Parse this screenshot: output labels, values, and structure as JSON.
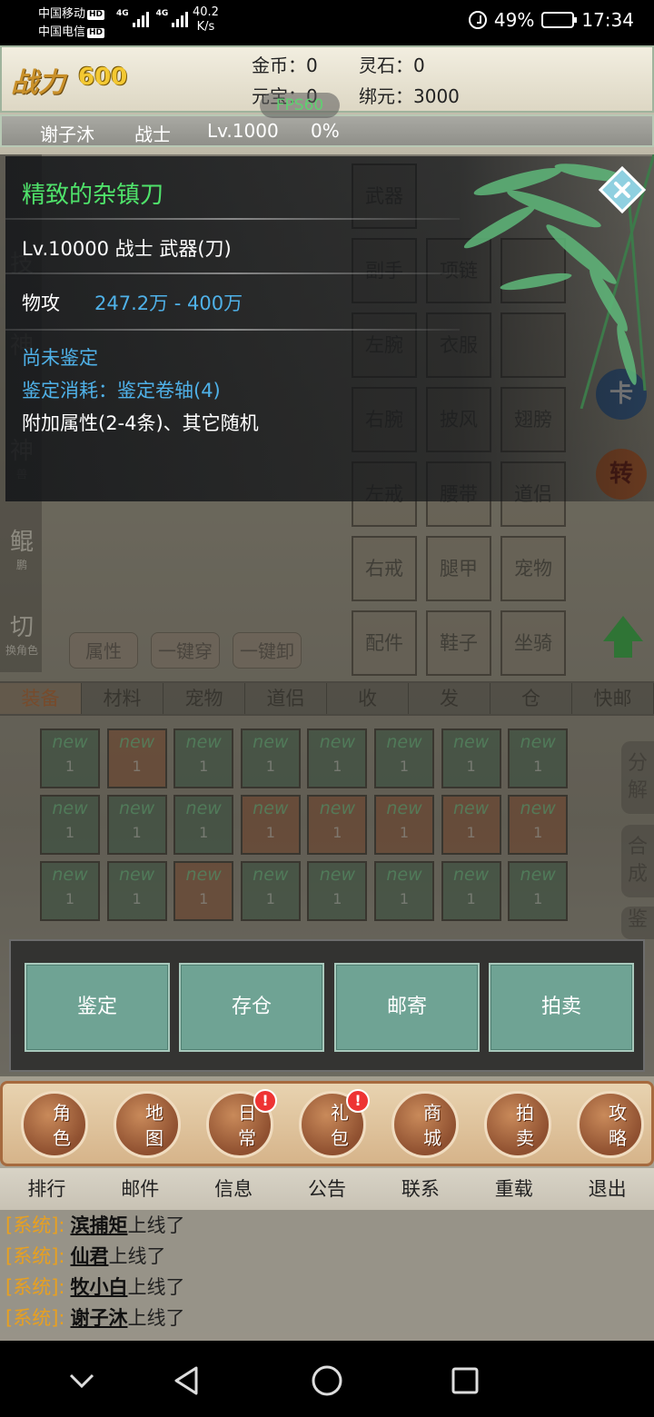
{
  "status_bar": {
    "carrier1": "中国移动",
    "carrier2": "中国电信",
    "hd": "HD",
    "net1": "4G",
    "net2": "4G",
    "speed_value": "40.2",
    "speed_unit": "K/s",
    "battery": "49%",
    "time": "17:34",
    "battery_level": 0.49
  },
  "resources": {
    "power_label": "战力",
    "power_value": "600",
    "gold": "金币：0",
    "lingshi": "灵石：0",
    "yuanbao": "元宝：0",
    "bangyuan": "绑元：3000",
    "fps": "FPS60"
  },
  "character": {
    "name": "谢子沐",
    "class": "战士",
    "level": "Lv.1000",
    "exp": "0%"
  },
  "side_tabs": [
    {
      "label": "技",
      "sub": ""
    },
    {
      "label": "神",
      "sub": ""
    },
    {
      "label": "神",
      "sub": "兽"
    },
    {
      "label": "鲲",
      "sub": "鹏"
    },
    {
      "label": "切",
      "sub": "换角色"
    }
  ],
  "equipment_slots": [
    "武器",
    "副手",
    "项链",
    "左腕",
    "衣服",
    "右腕",
    "披风",
    "翅膀",
    "左戒",
    "腰带",
    "道侣",
    "右戒",
    "腿甲",
    "宠物",
    "配件",
    "鞋子",
    "坐骑"
  ],
  "equip_buttons": [
    "属性",
    "一键穿",
    "一键卸"
  ],
  "right_orbs": [
    "卡",
    "转"
  ],
  "bag_tabs": [
    "装备",
    "材料",
    "宠物",
    "道侣",
    "收",
    "发",
    "仓",
    "快邮"
  ],
  "bag_item_label": "new",
  "bag_item_count": "1",
  "bag_side": {
    "decompose": "分解",
    "synthesize": "合成",
    "appraise": "鉴"
  },
  "tooltip": {
    "item_name": "精致的杂镇刀",
    "level_line": "Lv.10000 战士 武器(刀)",
    "attack_label": "物攻",
    "attack_value": "247.2万 - 400万",
    "unidentified": "尚未鉴定",
    "cost": "鉴定消耗：鉴定卷轴(4)",
    "extra": "附加属性(2-4条)、其它随机"
  },
  "actions": {
    "appraise": "鉴定",
    "store": "存仓",
    "mail": "邮寄",
    "auction": "拍卖"
  },
  "main_nav": [
    {
      "label": "角色",
      "badge": ""
    },
    {
      "label": "地图",
      "badge": ""
    },
    {
      "label": "日常",
      "badge": "!"
    },
    {
      "label": "礼包",
      "badge": "!"
    },
    {
      "label": "商城",
      "badge": ""
    },
    {
      "label": "拍卖",
      "badge": ""
    },
    {
      "label": "攻略",
      "badge": ""
    }
  ],
  "sub_nav": [
    "排行",
    "邮件",
    "信息",
    "公告",
    "联系",
    "重载",
    "退出"
  ],
  "chat": [
    {
      "tag": "[系统]:",
      "name": "滨捕矩",
      "msg": "上线了"
    },
    {
      "tag": "[系统]:",
      "name": "仙君",
      "msg": "上线了"
    },
    {
      "tag": "[系统]:",
      "name": "牧小白",
      "msg": "上线了"
    },
    {
      "tag": "[系统]:",
      "name": "谢子沐",
      "msg": "上线了"
    }
  ],
  "colors": {
    "item_name": "#4fe26a",
    "stat_blue": "#4fb1e8",
    "action_button": "#6fa394",
    "chat_tag": "#e8a020"
  }
}
